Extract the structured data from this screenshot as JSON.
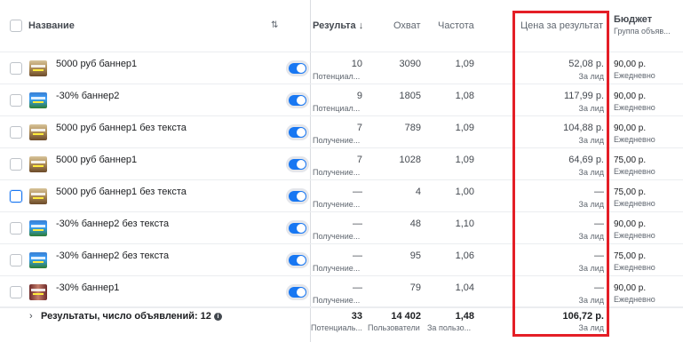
{
  "header": {
    "name": "Название",
    "results": "Результа",
    "results_arrow": "↓",
    "reach": "Охват",
    "frequency": "Частота",
    "cost_per_result": "Цена за результат",
    "budget": "Бюджет",
    "budget_sub": "Группа объяв..."
  },
  "rows": [
    {
      "name": "5000 руб баннер1",
      "thumb": "t1",
      "results": "10",
      "results_sub": "Потенциал...",
      "reach": "3090",
      "frequency": "1,09",
      "cost": "52,08 р.",
      "cost_sub": "За лид",
      "budget": "90,00 р.",
      "budget_sub": "Ежедневно"
    },
    {
      "name": "-30% баннер2",
      "thumb": "t2",
      "results": "9",
      "results_sub": "Потенциал...",
      "reach": "1805",
      "frequency": "1,08",
      "cost": "117,99 р.",
      "cost_sub": "За лид",
      "budget": "90,00 р.",
      "budget_sub": "Ежедневно"
    },
    {
      "name": "5000 руб баннер1 без текста",
      "thumb": "t1",
      "results": "7",
      "results_sub": "Получение...",
      "reach": "789",
      "frequency": "1,09",
      "cost": "104,88 р.",
      "cost_sub": "За лид",
      "budget": "90,00 р.",
      "budget_sub": "Ежедневно"
    },
    {
      "name": "5000 руб баннер1",
      "thumb": "t1",
      "results": "7",
      "results_sub": "Получение...",
      "reach": "1028",
      "frequency": "1,09",
      "cost": "64,69 р.",
      "cost_sub": "За лид",
      "budget": "75,00 р.",
      "budget_sub": "Ежедневно"
    },
    {
      "name": "5000 руб баннер1 без текста",
      "thumb": "t1",
      "results": "—",
      "results_sub": "Получение...",
      "reach": "4",
      "frequency": "1,00",
      "cost": "—",
      "cost_sub": "За лид",
      "budget": "75,00 р.",
      "budget_sub": "Ежедневно"
    },
    {
      "name": "-30% баннер2 без текста",
      "thumb": "t2",
      "results": "—",
      "results_sub": "Получение...",
      "reach": "48",
      "frequency": "1,10",
      "cost": "—",
      "cost_sub": "За лид",
      "budget": "90,00 р.",
      "budget_sub": "Ежедневно"
    },
    {
      "name": "-30% баннер2 без текста",
      "thumb": "t2",
      "results": "—",
      "results_sub": "Получение...",
      "reach": "95",
      "frequency": "1,06",
      "cost": "—",
      "cost_sub": "За лид",
      "budget": "75,00 р.",
      "budget_sub": "Ежедневно"
    },
    {
      "name": "-30% баннер1",
      "thumb": "t3",
      "results": "—",
      "results_sub": "Получение...",
      "reach": "79",
      "frequency": "1,04",
      "cost": "—",
      "cost_sub": "За лид",
      "budget": "90,00 р.",
      "budget_sub": "Ежедневно"
    }
  ],
  "summary": {
    "label": "Результаты, число объявлений: 12",
    "results": "33",
    "results_sub": "Потенциаль...",
    "reach": "14 402",
    "reach_sub": "Пользователи",
    "frequency": "1,48",
    "frequency_sub": "За пользо...",
    "cost": "106,72 р.",
    "cost_sub": "За лид"
  },
  "colors": {
    "accent": "#1877f2",
    "highlight": "#e41e26"
  }
}
